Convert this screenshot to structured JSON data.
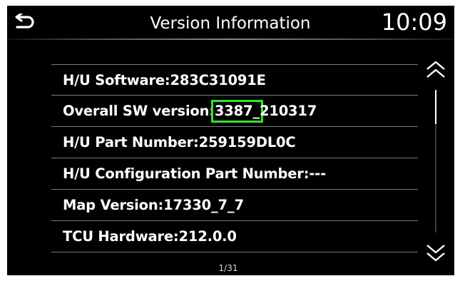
{
  "header": {
    "title": "Version Information",
    "clock": "10:09",
    "back_icon": "back-arrow-icon"
  },
  "items": [
    {
      "label": "H/U Software:283C31091E"
    },
    {
      "label_prefix": "Overall SW version:",
      "label_highlight": "3387_",
      "label_suffix": "210317"
    },
    {
      "label": "H/U Part Number:259159DL0C"
    },
    {
      "label": "H/U Configuration Part Number:---"
    },
    {
      "label": "Map Version:17330_7_7"
    },
    {
      "label": "TCU Hardware:212.0.0"
    }
  ],
  "pagination": {
    "indicator": "1/31"
  },
  "scroll": {
    "up_icon": "double-chevron-up-icon",
    "down_icon": "double-chevron-down-icon"
  },
  "colors": {
    "background": "#000000",
    "text": "#ffffff",
    "highlight": "#2ee52e",
    "divider": "#7a7a7a"
  }
}
